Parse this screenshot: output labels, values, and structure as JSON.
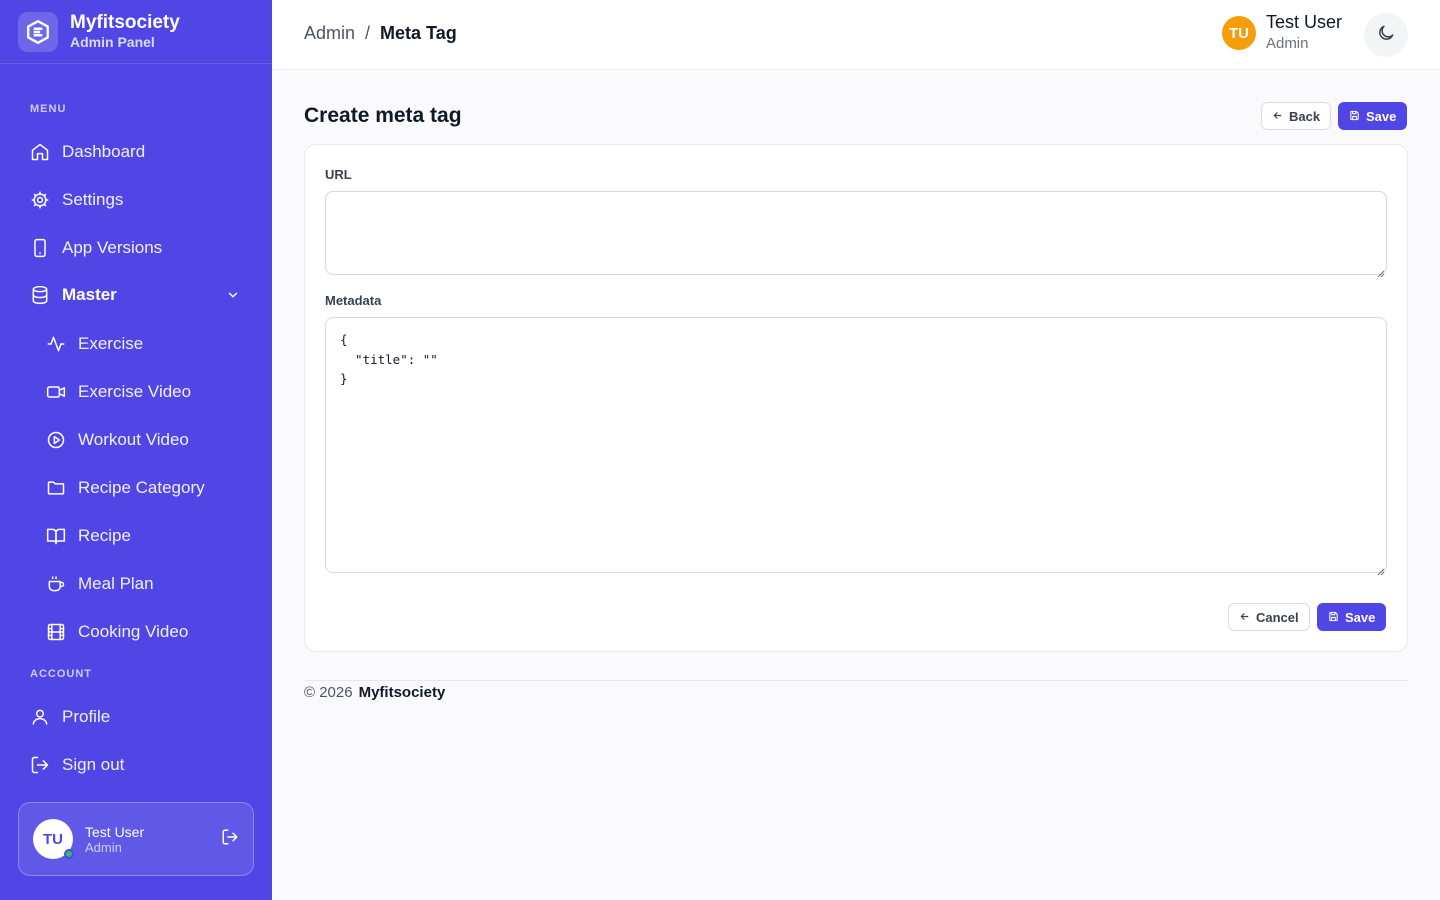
{
  "brand": {
    "name": "Myfitsociety",
    "subtitle": "Admin Panel"
  },
  "sidebar": {
    "menu_label": "MENU",
    "items": [
      {
        "label": "Dashboard",
        "icon": "home-icon"
      },
      {
        "label": "Settings",
        "icon": "gear-icon"
      },
      {
        "label": "App Versions",
        "icon": "smartphone-icon"
      },
      {
        "label": "Master",
        "icon": "database-icon",
        "expanded": true
      }
    ],
    "sub_items": [
      {
        "label": "Exercise",
        "icon": "activity-icon"
      },
      {
        "label": "Exercise Video",
        "icon": "video-camera-icon"
      },
      {
        "label": "Workout Video",
        "icon": "play-circle-icon"
      },
      {
        "label": "Recipe Category",
        "icon": "folder-icon"
      },
      {
        "label": "Recipe",
        "icon": "book-open-icon"
      },
      {
        "label": "Meal Plan",
        "icon": "coffee-cup-icon"
      },
      {
        "label": "Cooking Video",
        "icon": "film-icon"
      }
    ],
    "account_label": "ACCOUNT",
    "account_items": [
      {
        "label": "Profile",
        "icon": "user-icon"
      },
      {
        "label": "Sign out",
        "icon": "sign-out-icon"
      }
    ],
    "user": {
      "initials": "TU",
      "name": "Test User",
      "role": "Admin"
    }
  },
  "header": {
    "breadcrumb": {
      "root": "Admin",
      "separator": "/",
      "current": "Meta Tag"
    },
    "user": {
      "initials": "TU",
      "name": "Test User",
      "role": "Admin"
    }
  },
  "page": {
    "title": "Create meta tag",
    "back_label": "Back",
    "save_label": "Save"
  },
  "form": {
    "url_label": "URL",
    "url_value": "",
    "metadata_label": "Metadata",
    "metadata_value": "{\n  \"title\": \"\"\n}",
    "cancel_label": "Cancel",
    "save_label": "Save"
  },
  "footer": {
    "copyright": "© 2026",
    "brand": "Myfitsociety"
  },
  "colors": {
    "accent": "#4f46e5",
    "avatar": "#f59e0b",
    "online": "#22c55e"
  }
}
